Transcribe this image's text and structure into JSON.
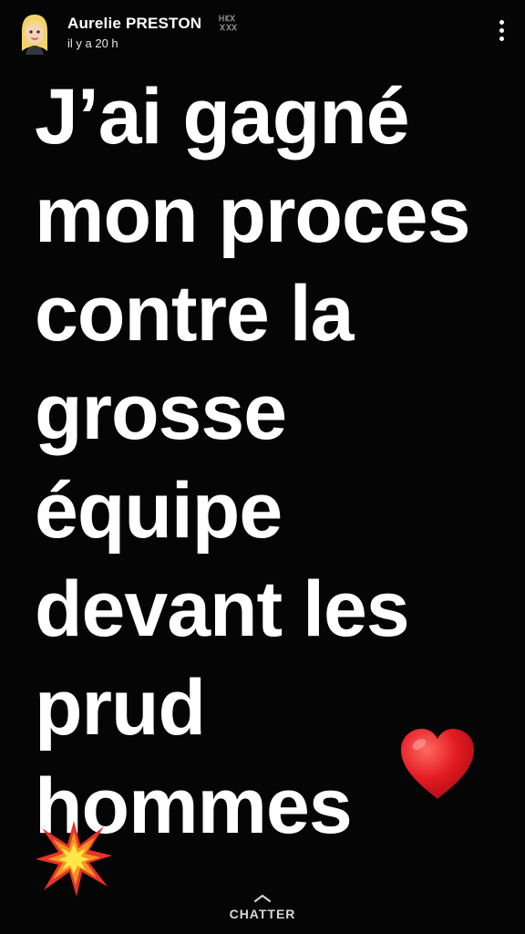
{
  "header": {
    "user_name": "Aurelie PRESTON",
    "timestamp": "il y a 20 h",
    "zodiac_icon": "zodiac-scorpio-icon",
    "menu_icon": "more-vertical-icon"
  },
  "story": {
    "lines": [
      "J’ai gagné",
      "mon proces",
      "contre la",
      "grosse",
      "équipe",
      "devant les",
      "prud",
      "hommes"
    ],
    "emojis": [
      "red-heart",
      "collision"
    ],
    "text_color": "#ffffff",
    "background_color": "#050505"
  },
  "footer": {
    "chat_label": "CHATTER",
    "chat_icon": "chevron-up-icon"
  }
}
